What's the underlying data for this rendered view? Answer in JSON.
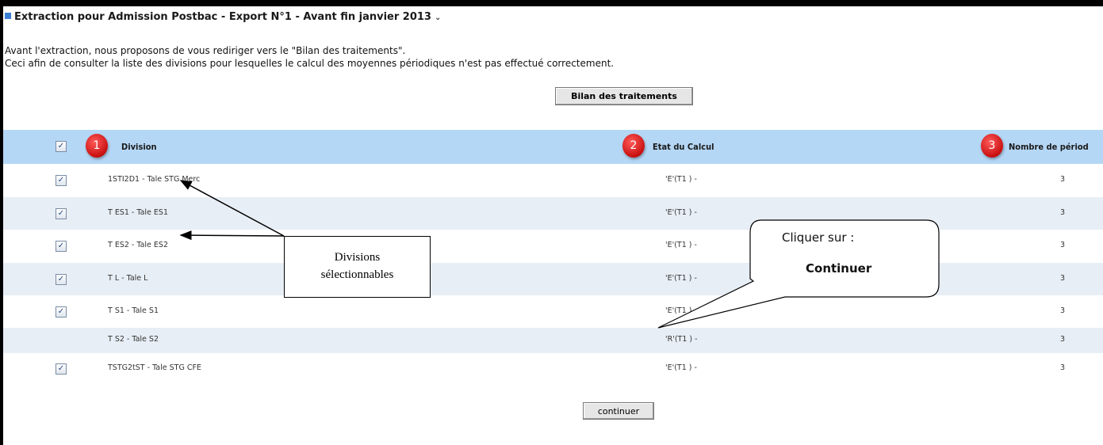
{
  "header": {
    "title": "Extraction pour Admission Postbac - Export N°1 - Avant fin janvier 2013"
  },
  "intro": {
    "line1": "Avant l'extraction, nous proposons de vous rediriger vers le \"Bilan des traitements\".",
    "line2": "Ceci afin de consulter la liste des divisions pour lesquelles le calcul des moyennes périodiques n'est pas effectué correctement."
  },
  "buttons": {
    "bilan": "Bilan des traitements",
    "continuer": "continuer"
  },
  "table": {
    "columns": {
      "division": "Division",
      "etat": "Etat du Calcul",
      "nombre": "Nombre de périod"
    },
    "badges": [
      "1",
      "2",
      "3"
    ],
    "rows": [
      {
        "checked": true,
        "division": "1STI2D1 - Tale STG Merc",
        "etat": "'E'(T1 ) -",
        "nombre": "3"
      },
      {
        "checked": true,
        "division": "T ES1 - Tale ES1",
        "etat": "'E'(T1 ) -",
        "nombre": "3"
      },
      {
        "checked": true,
        "division": "T ES2 - Tale ES2",
        "etat": "'E'(T1 ) -",
        "nombre": "3"
      },
      {
        "checked": true,
        "division": "T L - Tale L",
        "etat": "'E'(T1 ) -",
        "nombre": "3"
      },
      {
        "checked": true,
        "division": "T S1 - Tale S1",
        "etat": "'E'(T1 ) -",
        "nombre": "3"
      },
      {
        "checked": false,
        "division": "T S2 - Tale S2",
        "etat": "'R'(T1 ) -",
        "nombre": "3"
      },
      {
        "checked": true,
        "division": "TSTG2tST - Tale STG CFE",
        "etat": "'E'(T1 ) -",
        "nombre": "3"
      }
    ]
  },
  "annotations": {
    "divisions_line1": "Divisions",
    "divisions_line2": "sélectionnables",
    "bubble_line1": "Cliquer sur :",
    "bubble_line2": "Continuer"
  },
  "colors": {
    "header_bg": "#b5d7f6",
    "row_alt": "#e8eef5",
    "badge_red": "#d11414"
  }
}
